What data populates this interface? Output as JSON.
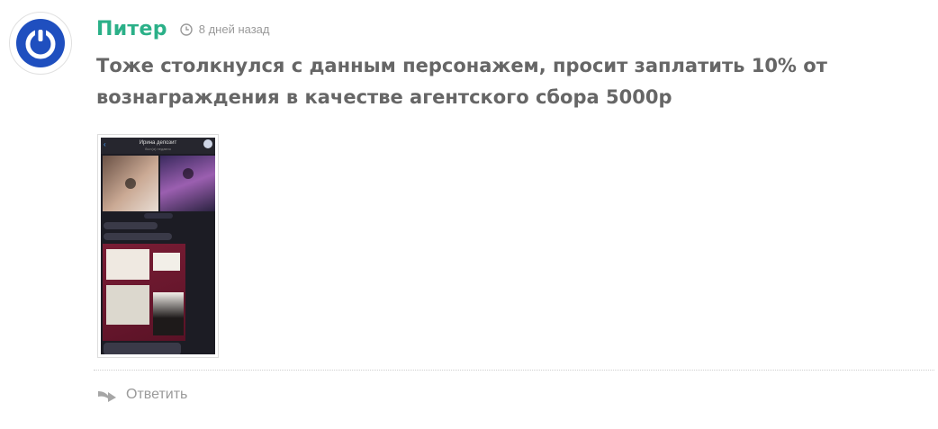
{
  "comment": {
    "author": "Питер",
    "time": "8 дней назад",
    "text": "Тоже столкнулся с данным персонажем, просит заплатить 10% от вознаграждения в качестве агентского сбора 5000р",
    "avatar_icon": "power-icon",
    "time_icon": "clock-icon",
    "attachment": {
      "title": "Ирина депозит",
      "subtitle": "был(а) недавно"
    },
    "reply_label": "Ответить",
    "reply_icon": "reply-arrow-icon"
  },
  "colors": {
    "author": "#2bb088",
    "avatar_ring": "#1f4fbf",
    "text": "#666666",
    "muted": "#9a9a9a"
  }
}
